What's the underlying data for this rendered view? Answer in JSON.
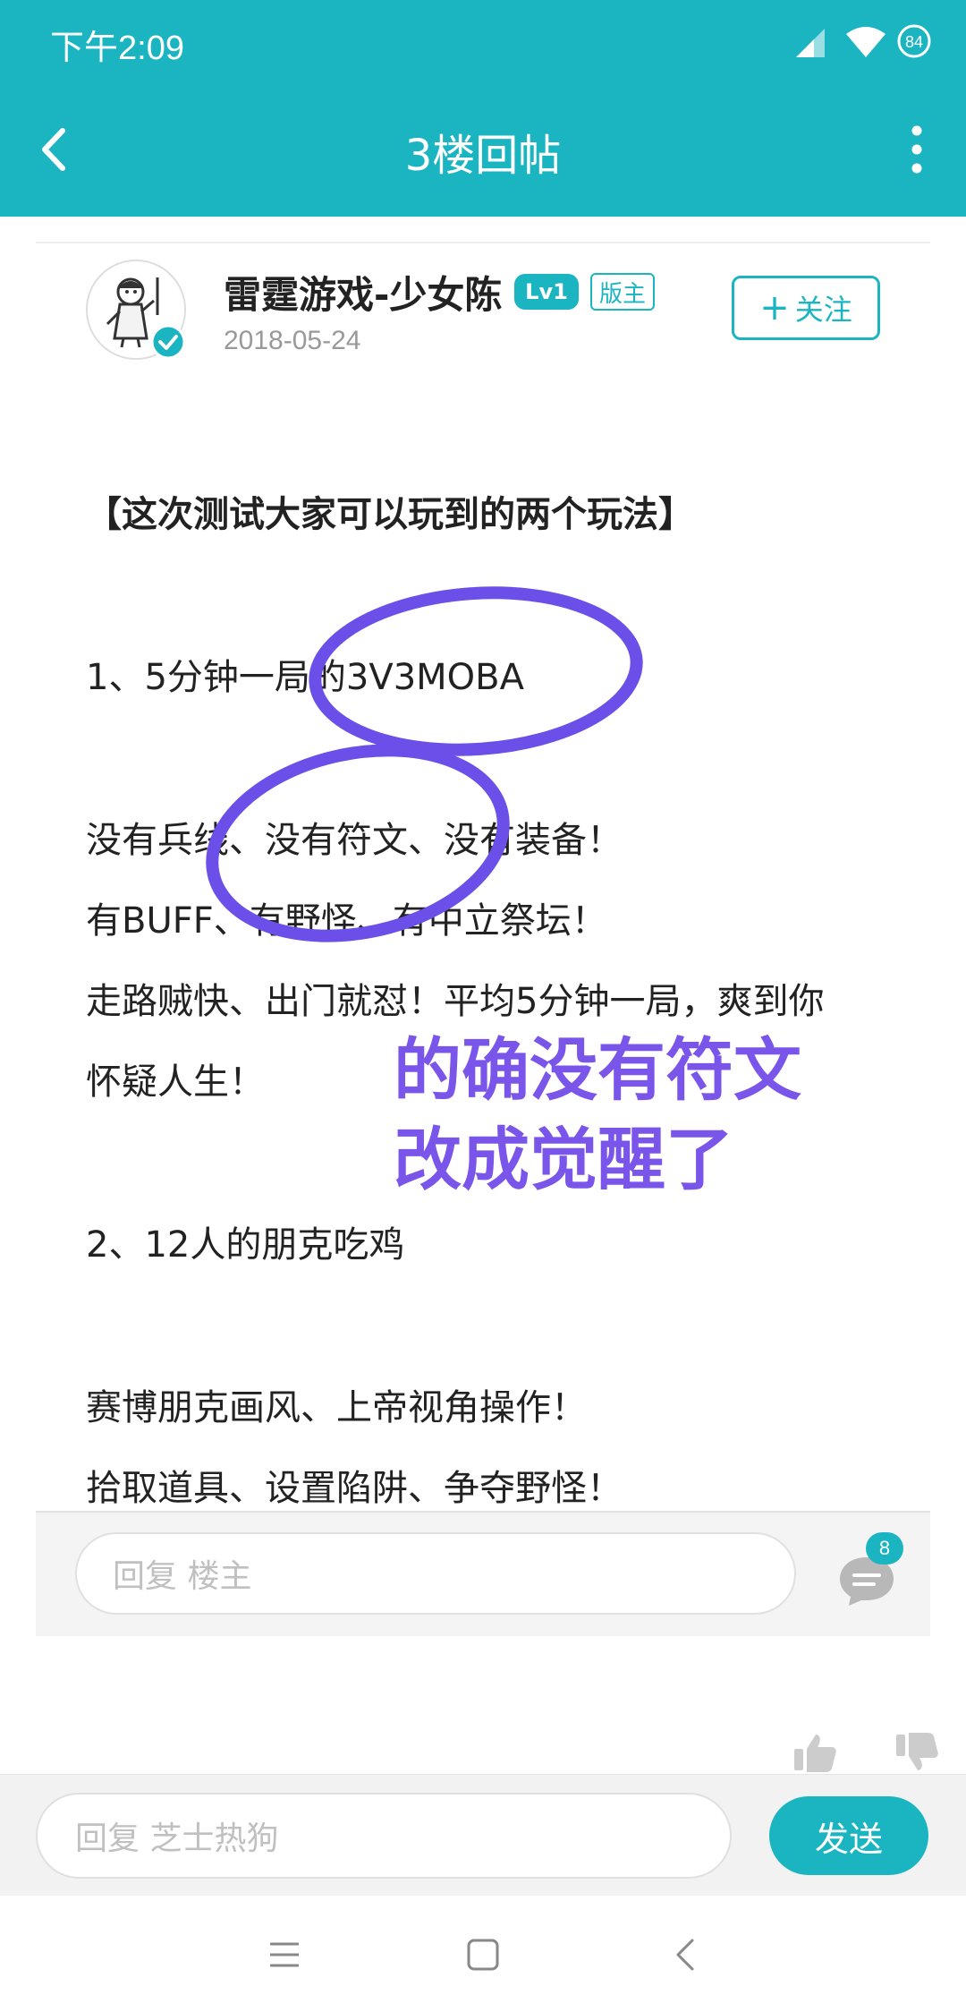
{
  "status_bar": {
    "time": "下午2:09",
    "battery": "84",
    "icons": [
      "signal-icon",
      "wifi-icon",
      "battery-icon"
    ]
  },
  "app_bar": {
    "title": "3楼回帖",
    "back_icon": "back-arrow-icon",
    "more_icon": "more-vertical-icon"
  },
  "author": {
    "name": "雷霆游戏-少女陈",
    "level": "Lv1",
    "role": "版主",
    "date": "2018-05-24",
    "follow_label": "关注",
    "follow_icon": "plus-icon",
    "avatar_icon": "avatar-icon",
    "verified_icon": "verified-badge-icon"
  },
  "post": {
    "heading": "【这次测试大家可以玩到的两个玩法】",
    "lines": [
      "1、5分钟一局的3V3MOBA",
      "没有兵线、没有符文、没有装备！",
      "有BUFF、有野怪、有中立祭坛！",
      "走路贼快、出门就怼！平均5分钟一局，爽到你",
      "怀疑人生！",
      "2、12人的朋克吃鸡",
      "赛博朋克画风、上帝视角操作！",
      "拾取道具、设置陷阱、争夺野怪！"
    ]
  },
  "annotation": {
    "line1": "的确没有符文",
    "line2": "改成觉醒了",
    "color": "#7a55ea"
  },
  "reply_box": {
    "placeholder": "回复  楼主",
    "comment_count": "8"
  },
  "bottom_bar": {
    "placeholder": "回复 芝士热狗",
    "send_label": "发送"
  },
  "colors": {
    "accent": "#1bb5c2",
    "annotation": "#7a55ea"
  }
}
